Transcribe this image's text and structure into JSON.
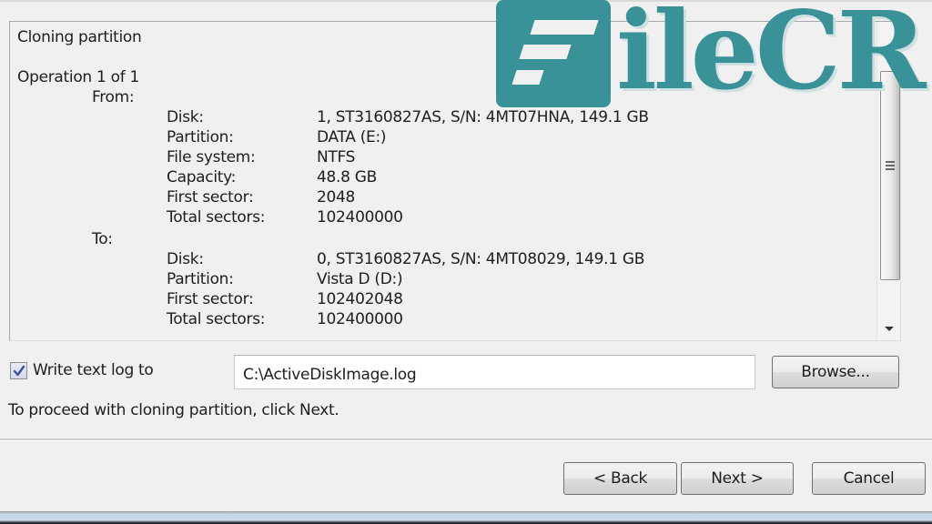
{
  "summary": {
    "title": "Cloning partition",
    "operation": "Operation 1 of 1",
    "from_label": "From:",
    "to_label": "To:",
    "from": [
      {
        "label": "Disk:",
        "value": "1, ST3160827AS, S/N: 4MT07HNA, 149.1 GB"
      },
      {
        "label": "Partition:",
        "value": "DATA (E:)"
      },
      {
        "label": "File system:",
        "value": "NTFS"
      },
      {
        "label": "Capacity:",
        "value": "48.8 GB"
      },
      {
        "label": "First sector:",
        "value": "2048"
      },
      {
        "label": "Total sectors:",
        "value": "102400000"
      }
    ],
    "to": [
      {
        "label": "Disk:",
        "value": "0, ST3160827AS, S/N: 4MT08029, 149.1 GB"
      },
      {
        "label": "Partition:",
        "value": "Vista D (D:)"
      },
      {
        "label": "First sector:",
        "value": "102402048"
      },
      {
        "label": "Total sectors:",
        "value": "102400000"
      }
    ]
  },
  "log": {
    "checkbox_label": "Write text log to",
    "checked": true,
    "path_value": "C:\\ActiveDiskImage.log",
    "browse_label": "Browse..."
  },
  "hint": "To proceed with cloning partition, click Next.",
  "buttons": {
    "back": "< Back",
    "next": "Next >",
    "cancel": "Cancel"
  },
  "watermark": {
    "text": "ileCR",
    "color": "#3a9299"
  }
}
